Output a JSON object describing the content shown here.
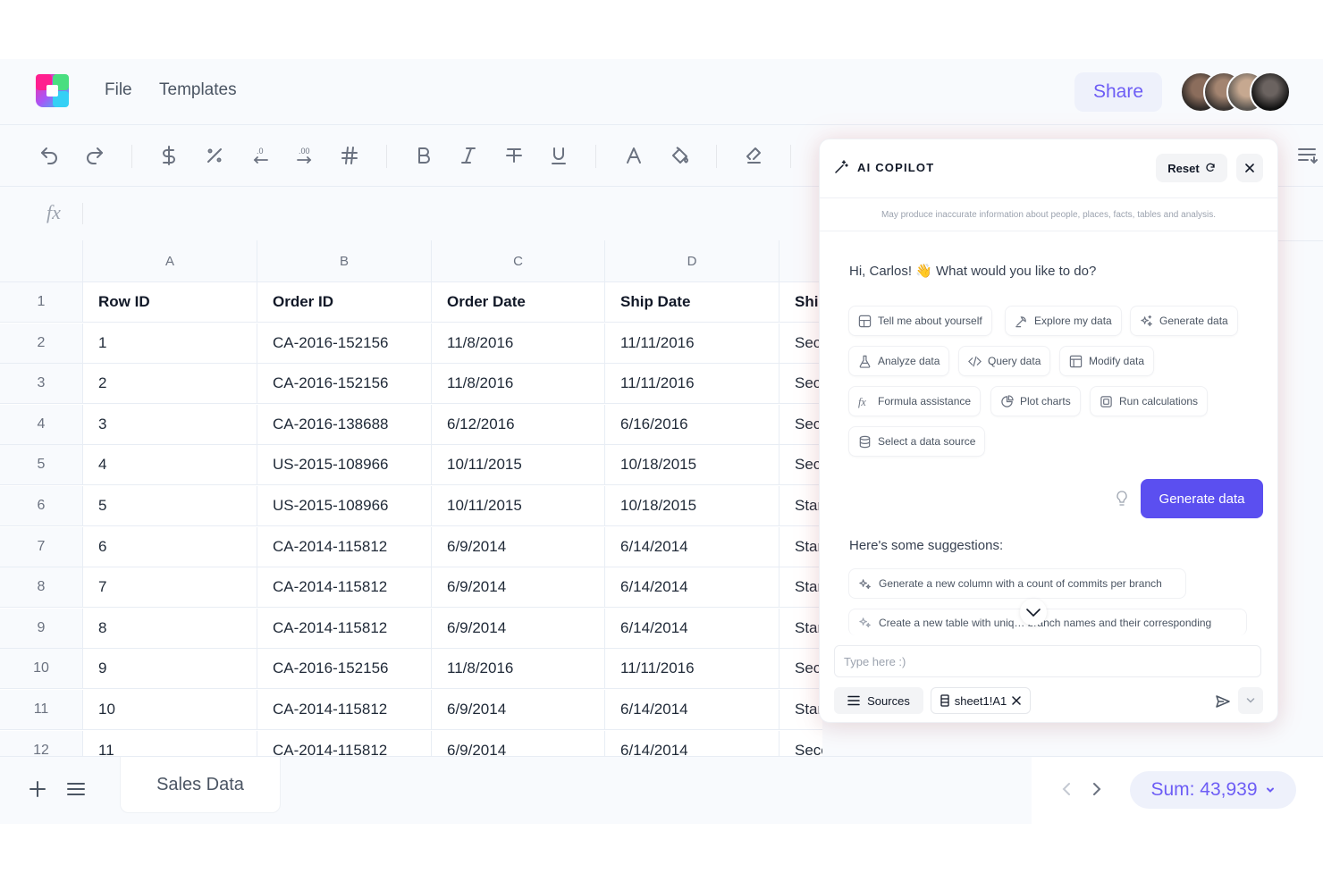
{
  "menu": {
    "file": "File",
    "templates": "Templates"
  },
  "share_label": "Share",
  "formula": {
    "fx": "fx",
    "value": ""
  },
  "grid": {
    "columns": [
      "A",
      "B",
      "C",
      "D",
      ""
    ],
    "row_numbers": [
      "1",
      "2",
      "3",
      "4",
      "5",
      "6",
      "7",
      "8",
      "9",
      "10",
      "11",
      "12"
    ],
    "rows": [
      [
        "Row ID",
        "Order ID",
        "Order Date",
        "Ship Date",
        "Ship"
      ],
      [
        "1",
        "CA-2016-152156",
        "11/8/2016",
        "11/11/2016",
        "Sec"
      ],
      [
        "2",
        "CA-2016-152156",
        "11/8/2016",
        "11/11/2016",
        "Sec"
      ],
      [
        "3",
        "CA-2016-138688",
        "6/12/2016",
        "6/16/2016",
        "Sec"
      ],
      [
        "4",
        "US-2015-108966",
        "10/11/2015",
        "10/18/2015",
        "Sec"
      ],
      [
        "5",
        "US-2015-108966",
        "10/11/2015",
        "10/18/2015",
        "Star"
      ],
      [
        "6",
        "CA-2014-115812",
        "6/9/2014",
        "6/14/2014",
        "Star"
      ],
      [
        "7",
        "CA-2014-115812",
        "6/9/2014",
        "6/14/2014",
        "Star"
      ],
      [
        "8",
        "CA-2014-115812",
        "6/9/2014",
        "6/14/2014",
        "Star"
      ],
      [
        "9",
        "CA-2016-152156",
        "11/8/2016",
        "11/11/2016",
        "Sec"
      ],
      [
        "10",
        "CA-2014-115812",
        "6/9/2014",
        "6/14/2014",
        "Star"
      ],
      [
        "11",
        "CA-2014-115812",
        "6/9/2014",
        "6/14/2014",
        "Second Cla"
      ]
    ]
  },
  "sheet_tab": "Sales Data",
  "sum_label": "Sum: 43,939",
  "copilot": {
    "title": "AI COPILOT",
    "reset": "Reset",
    "disclaimer": "May produce inaccurate information about people, places, facts, tables and analysis.",
    "greeting": "Hi, Carlos! 👋 What would you like to do?",
    "chips": [
      "Tell me about yourself",
      "Explore my data",
      "Generate data",
      "Analyze data",
      "Query data",
      "Modify data",
      "Formula assistance",
      "Plot charts",
      "Run calculations",
      "Select a data source"
    ],
    "generate_button": "Generate data",
    "suggestions_title": "Here's some suggestions:",
    "suggestions": [
      "Generate a new column with a count of commits per branch",
      "Create a new table with uniq… branch names and their corresponding"
    ],
    "input_placeholder": "Type here :)",
    "sources": "Sources",
    "sheet_ref": "sheet1!A1"
  },
  "colors": {
    "accent": "#5b4ff0",
    "share_text": "#6d5df5"
  }
}
